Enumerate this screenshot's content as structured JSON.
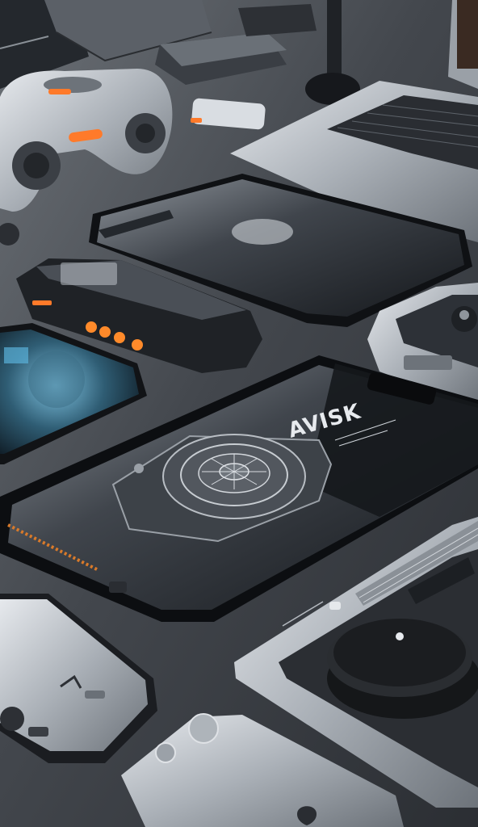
{
  "scene": {
    "description_tag": "photo",
    "palette": {
      "desk": "#3a3d42",
      "desk_highlight": "#5a5f66",
      "device_dark": "#1d2024",
      "device_glass": "#2a2e34",
      "device_silver": "#c9ced4",
      "led_orange": "#ff8a2a",
      "screen_blue": "#6fb6d6"
    },
    "phone_engraving": {
      "text": "AVISK"
    }
  }
}
